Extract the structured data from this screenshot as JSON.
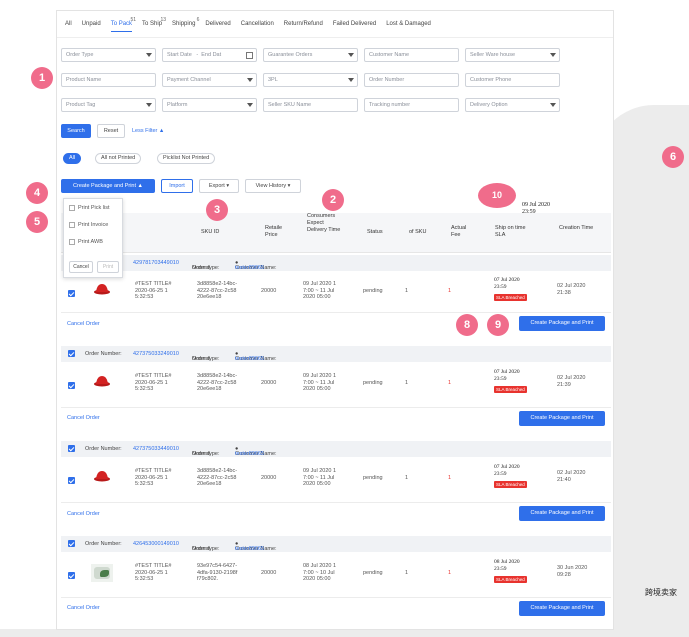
{
  "colors": {
    "accent": "#2f6fea",
    "danger": "#e8332e",
    "callout": "#f06c8b"
  },
  "tabs": [
    {
      "label": "All",
      "count": ""
    },
    {
      "label": "Unpaid",
      "count": ""
    },
    {
      "label": "To Pack",
      "count": "51"
    },
    {
      "label": "To Ship",
      "count": "13"
    },
    {
      "label": "Shipping",
      "count": "6"
    },
    {
      "label": "Delivered",
      "count": ""
    },
    {
      "label": "Cancellation",
      "count": ""
    },
    {
      "label": "Return/Refund",
      "count": ""
    },
    {
      "label": "Failed Delivered",
      "count": ""
    },
    {
      "label": "Lost & Damaged",
      "count": ""
    }
  ],
  "filters": {
    "order_type": "Order Type",
    "start_date": "Start Date",
    "end_date": "End Dat",
    "guarantee_orders": "Guarantee Orders",
    "customer_name": "Customer Name",
    "seller_warehouse": "Seller Ware house",
    "product_name": "Product Name",
    "payment_channel": "Payment Channel",
    "3pl": "3PL",
    "order_number": "Order Number",
    "customer_phone": "Customer Phone",
    "product_tag": "Product Tag",
    "platform": "Platform",
    "seller_sku_name": "Seller SKU Name",
    "tracking_number": "Tracking number",
    "delivery_option": "Delivery Option"
  },
  "actions": {
    "search": "Search",
    "reset": "Reset",
    "less_filter": "Less Filter"
  },
  "print_pills": [
    "All",
    "All not Printed",
    "Picklist Not Printed"
  ],
  "toolbar": {
    "create_package": "Create Package and Print",
    "import": "Import",
    "export": "Export",
    "view_history": "View History"
  },
  "print_menu": {
    "items": [
      "Print Pick list",
      "Print Invoice",
      "Print AWB"
    ],
    "cancel": "Cancel",
    "print": "Print"
  },
  "table_headers": {
    "sku": "SKU ID",
    "retail_price": "Retaile\nPrice",
    "consumers_expect": "Consumers\nExpect\nDelivery Time",
    "status": "Status",
    "qty_sku": "of SKU",
    "actual_fee": "Actual\nFee",
    "ship_on_time": "Ship on time\nSLA",
    "creation_time": "Creation Time"
  },
  "labels": {
    "order_number": "Order Number:",
    "order_type": "Order type:",
    "customer_name": "Customer Name:",
    "cancel_order": "Cancel Order",
    "create_package_print": "Create Package and Print"
  },
  "orders": [
    {
      "number": "429781703449010",
      "type": "Normal",
      "customer": "tester89665",
      "title": "#TEST TITLE#\n2020-06-25 1\n5:32:53",
      "sku": "3d8858e2-14bc-\n4222-87cc-2c58\n20e6ee18",
      "price": "20000",
      "expect": "09 Jul 2020 1\n7:00 ~ 11 Jul\n2020 05:00",
      "status": "pending",
      "qty": "1",
      "fee": "1",
      "sla": "07 Jul 2020\n23:59",
      "sla_badge": "SLA Breached",
      "created": "02 Jul 2020\n21:38"
    },
    {
      "number": "427375033249010",
      "type": "Normal",
      "customer": "tester89665",
      "title": "#TEST TITLE#\n2020-06-25 1\n5:32:53",
      "sku": "3d8858e2-14bc-\n4222-87cc-2c58\n20e6ee18",
      "price": "20000",
      "expect": "09 Jul 2020 1\n7:00 ~ 11 Jul\n2020 05:00",
      "status": "pending",
      "qty": "1",
      "fee": "1",
      "sla": "07 Jul 2020\n23:59",
      "sla_badge": "SLA Breached",
      "created": "02 Jul 2020\n21:39"
    },
    {
      "number": "427375033449010",
      "type": "Normal",
      "customer": "tester89665",
      "title": "#TEST TITLE#\n2020-06-25 1\n5:32:53",
      "sku": "3d8858e2-14bc-\n4222-87cc-2c58\n20e6ee18",
      "price": "20000",
      "expect": "09 Jul 2020 1\n7:00 ~ 11 Jul\n2020 05:00",
      "status": "pending",
      "qty": "1",
      "fee": "1",
      "sla": "07 Jul 2020\n23:59",
      "sla_badge": "SLA Breached",
      "created": "02 Jul 2020\n21:40"
    },
    {
      "number": "426453000149010",
      "type": "Normal",
      "customer": "tester89665",
      "title": "#TEST TITLE#\n2020-06-25 1\n5:32:53",
      "sku": "93e97c54-6427-\n4dfa-9130-2198f\nf79c802.",
      "price": "20000",
      "expect": "08 Jul 2020 1\n7:00 ~ 10 Jul\n2020 05:00",
      "status": "pending",
      "qty": "1",
      "fee": "1",
      "sla": "08 Jul 2020\n23:59",
      "sla_badge": "SLA Breached",
      "created": "30 Jun 2020\n09:28"
    }
  ],
  "callouts": [
    "1",
    "2",
    "3",
    "4",
    "5",
    "6",
    "8",
    "9",
    "10"
  ],
  "float_date": "09 Jul 2020\n23:59",
  "watermark": "跨境卖家"
}
